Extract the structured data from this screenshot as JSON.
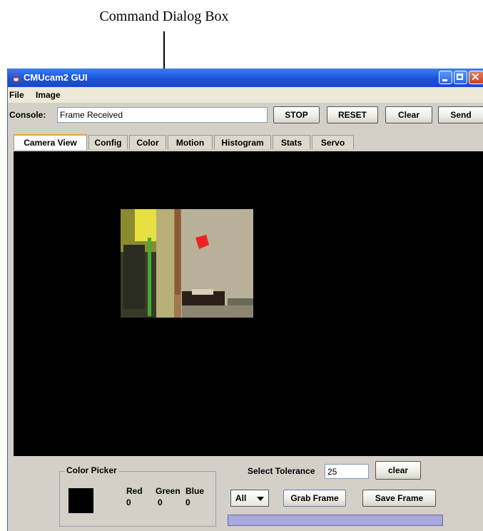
{
  "annotations": {
    "top_label": "Command Dialog Box"
  },
  "window": {
    "title": "CMUcam2 GUI",
    "app_icon": "java-cup-icon"
  },
  "menu": {
    "items": [
      "File",
      "Image"
    ]
  },
  "console": {
    "label": "Console:",
    "value": "Frame Received"
  },
  "toolbar": {
    "stop_label": "STOP",
    "reset_label": "RESET",
    "clear_label": "Clear",
    "send_label": "Send"
  },
  "tabs": [
    {
      "label": "Camera View",
      "active": true
    },
    {
      "label": "Config"
    },
    {
      "label": "Color"
    },
    {
      "label": "Motion"
    },
    {
      "label": "Histogram"
    },
    {
      "label": "Stats"
    },
    {
      "label": "Servo"
    }
  ],
  "color_picker": {
    "legend": "Color Picker",
    "swatch_color": "#000000",
    "red_label": "Red",
    "green_label": "Green",
    "blue_label": "Blue",
    "red": "0",
    "green": "0",
    "blue": "0"
  },
  "tolerance": {
    "label": "Select Tolerance",
    "value": "25",
    "clear_label": "clear"
  },
  "frame_controls": {
    "channel_selected": "All",
    "grab_label": "Grab Frame",
    "save_label": "Save Frame"
  },
  "progress": {
    "fraction": 1.0
  },
  "colors": {
    "titlebar": "#1a52d8",
    "window_bg": "#d4d0c8",
    "view_bg": "#000000",
    "progress_fill": "#a8a8dc"
  }
}
